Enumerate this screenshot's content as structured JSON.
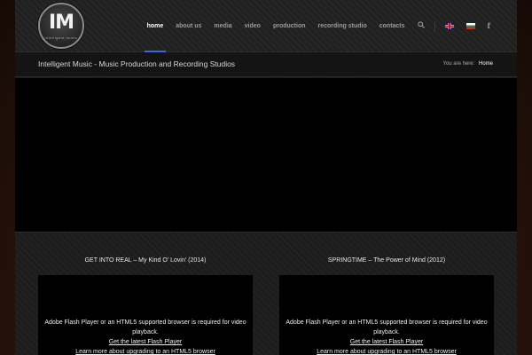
{
  "logo": {
    "mark": "IM",
    "sub": "intelligent music"
  },
  "nav": {
    "items": [
      {
        "label": "home",
        "active": true
      },
      {
        "label": "about us",
        "active": false
      },
      {
        "label": "media",
        "active": false
      },
      {
        "label": "video",
        "active": false
      },
      {
        "label": "production",
        "active": false
      },
      {
        "label": "recording studio",
        "active": false
      },
      {
        "label": "contacts",
        "active": false
      }
    ],
    "search_icon": "search-icon",
    "flags": [
      "uk-flag-icon",
      "bulgaria-flag-icon"
    ],
    "social_icon": "facebook-icon",
    "accent_color": "#3a6bd6"
  },
  "titlebar": {
    "title": "Intelligent Music - Music Production and Recording Studios",
    "breadcrumb_prefix": "You are here:",
    "breadcrumb_current": "Home"
  },
  "videos": [
    {
      "title": "GET INTO REAL – My Kind O' Lovin' (2014)",
      "message": "Adobe Flash Player or an HTML5 supported browser is required for video playback.",
      "link_flash": "Get the latest Flash Player",
      "link_html5": "Learn more about upgrading to an HTML5 browser"
    },
    {
      "title": "SPRINGTIME – The Power of Mind (2012)",
      "message": "Adobe Flash Player or an HTML5 supported browser is required for video playback.",
      "link_flash": "Get the latest Flash Player",
      "link_html5": "Learn more about upgrading to an HTML5 browser"
    }
  ]
}
